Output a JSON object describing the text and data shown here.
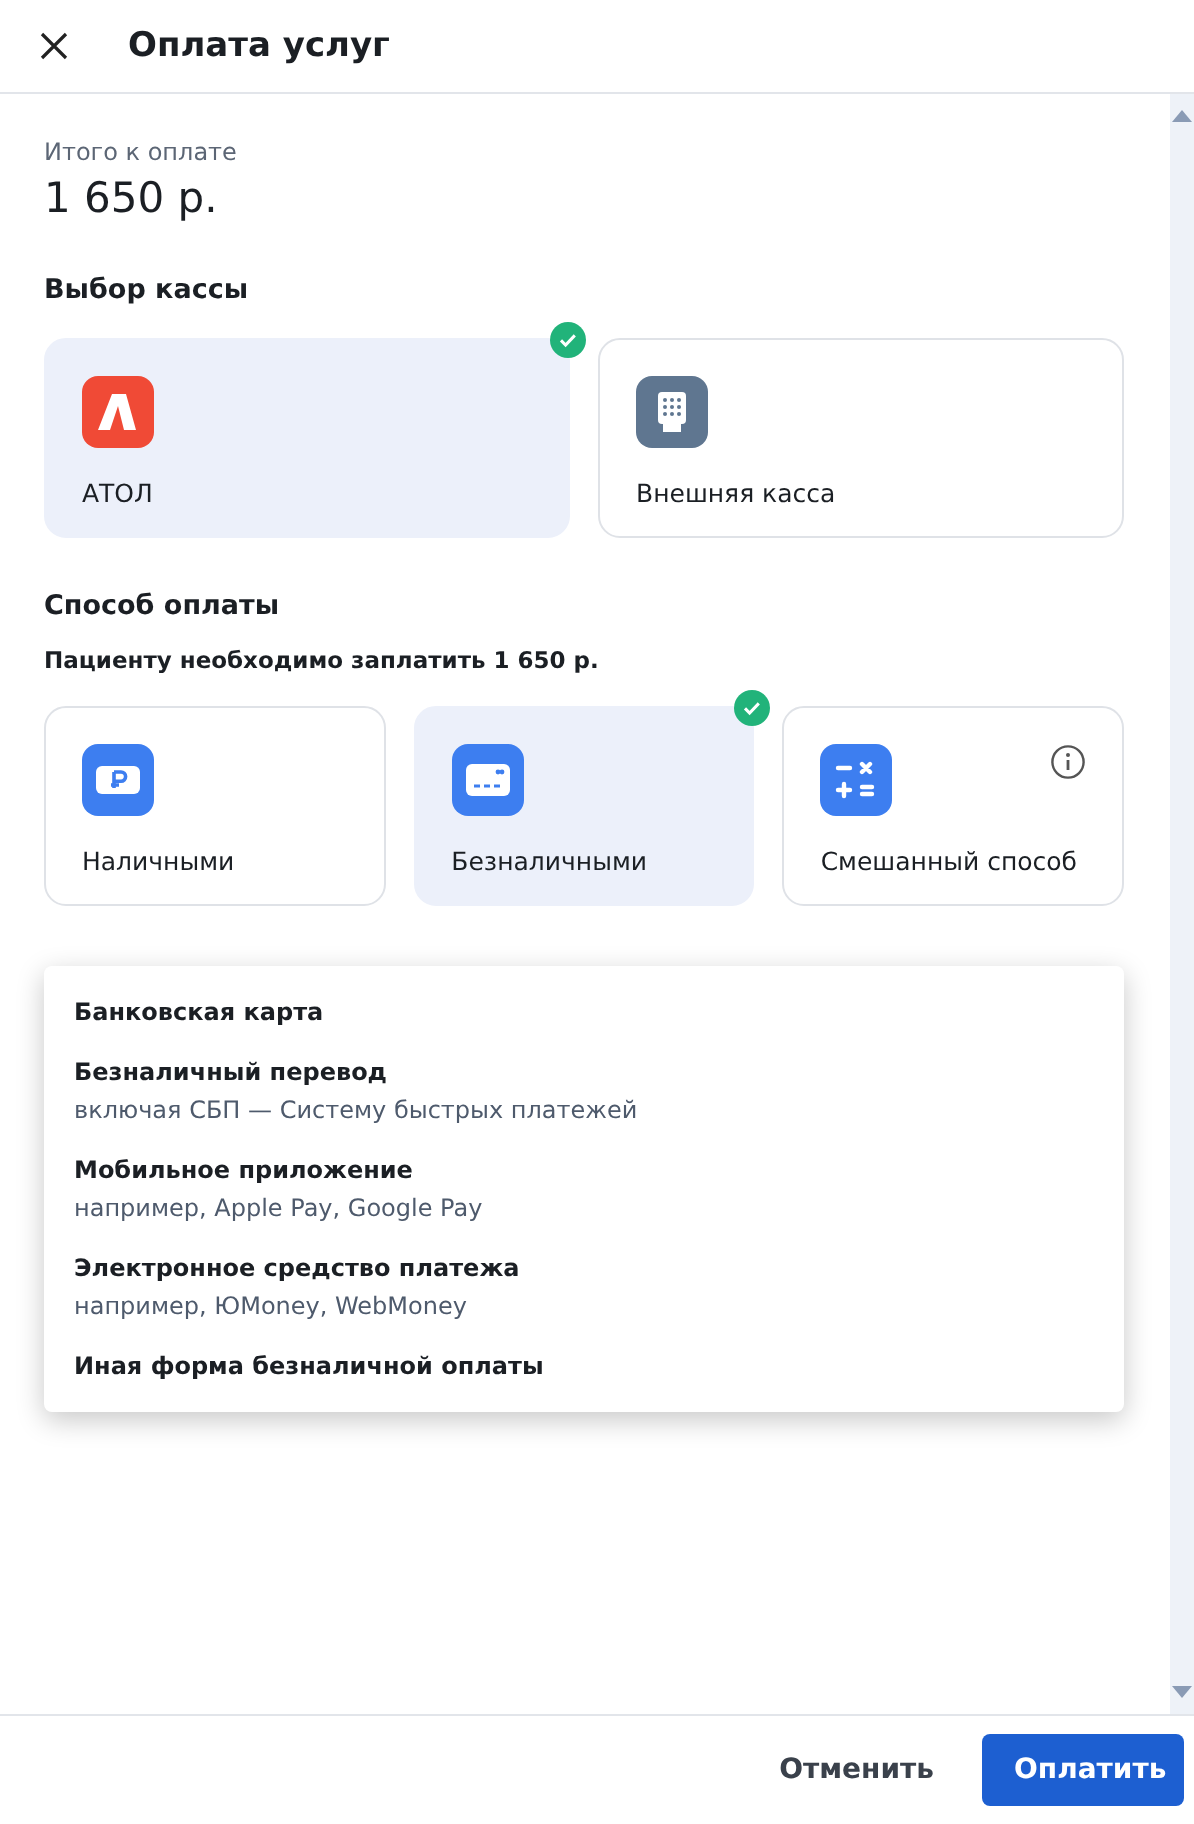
{
  "window": {
    "title": "Оплата услуг"
  },
  "total": {
    "label": "Итого к оплате",
    "amount": "1 650 р."
  },
  "cashbox": {
    "title": "Выбор кассы",
    "options": [
      {
        "kind": "atol",
        "label": "АТОЛ",
        "selected": true
      },
      {
        "kind": "external",
        "label": "Внешняя касса",
        "selected": false
      }
    ]
  },
  "payment": {
    "title": "Способ оплаты",
    "note": "Пациенту необходимо заплатить 1 650 р.",
    "options": [
      {
        "kind": "cash",
        "label": "Наличными",
        "selected": false,
        "info": false
      },
      {
        "kind": "card",
        "label": "Безналичными",
        "selected": true,
        "info": false
      },
      {
        "kind": "mixed",
        "label": "Смешанный способ",
        "selected": false,
        "info": true
      }
    ]
  },
  "cashless_field": {
    "dropdown": [
      {
        "title": "Банковская карта"
      },
      {
        "title": "Безналичный перевод",
        "hint": "включая СБП — Систему быстрых платежей"
      },
      {
        "title": "Мобильное приложение",
        "hint": "например, Apple Pay, Google Pay"
      },
      {
        "title": "Электронное средство платежа",
        "hint": "например, ЮMoney, WebMoney"
      },
      {
        "title": "Иная форма безналичной оплаты"
      }
    ]
  },
  "buttons": {
    "cancel": "Отменить",
    "confirm": "Оплатить"
  }
}
